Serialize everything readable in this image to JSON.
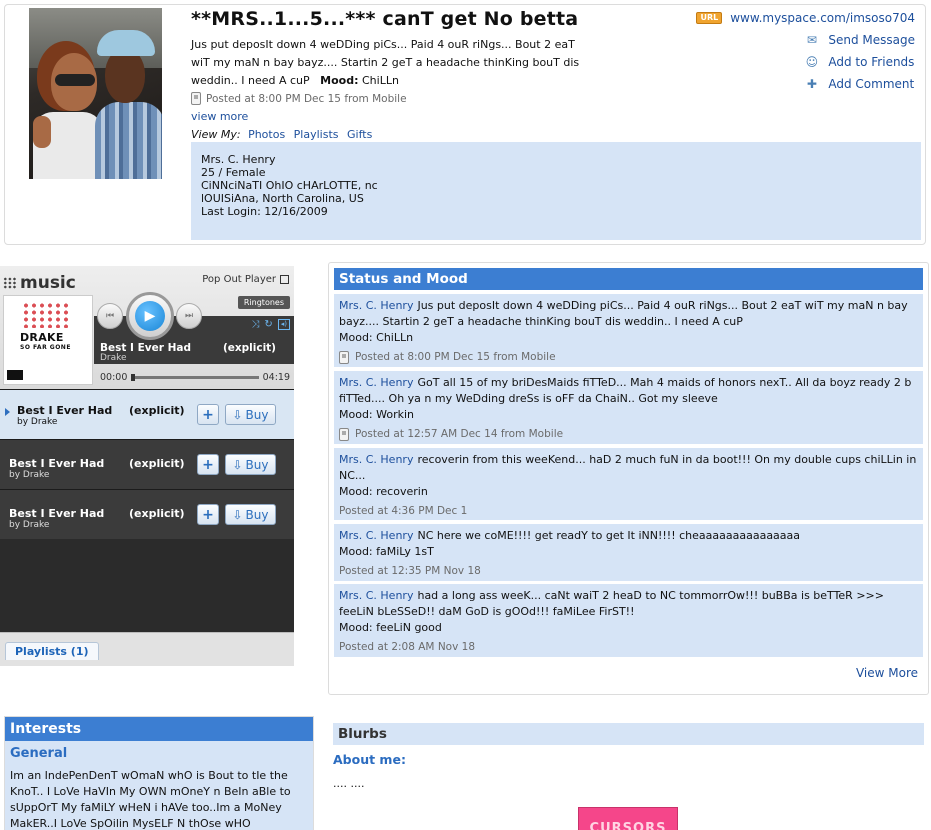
{
  "profile": {
    "name": "**MRS..1...5...*** canT get No betta",
    "headline": "Jus put deposIt down 4 weDDing piCs... Paid 4 ouR riNgs... Bout 2 eaT wiT my maN n bay bayz.... Startin 2 geT a headache thinKing bouT dis weddin.. I need A cuP",
    "mood_label": "Mood:",
    "mood_value": "ChiLLn",
    "posted": "Posted at 8:00 PM Dec 15 from Mobile",
    "view_more": "view more",
    "view_my_label": "View My:",
    "view_my_links": [
      "Photos",
      "Playlists",
      "Gifts"
    ],
    "url_badge": "URL",
    "url": "www.myspace.com/imsoso704",
    "actions": [
      {
        "label": "Send Message",
        "icon": "pencil-envelope-icon"
      },
      {
        "label": "Add to Friends",
        "icon": "add-friend-icon"
      },
      {
        "label": "Add Comment",
        "icon": "comment-icon"
      }
    ],
    "details": [
      "Mrs. C. Henry",
      "25 / Female",
      "CiNNciNaTI OhIO cHArLOTTE, nc",
      "lOUISiAna, North Carolina, US",
      "Last Login: 12/16/2009"
    ]
  },
  "player": {
    "logo_text": "music",
    "popout_label": "Pop Out Player",
    "album_title": "DRAKE",
    "album_sub": "SO FAR GONE",
    "ringtones_label": "Ringtones",
    "now_title": "Best I Ever Had",
    "now_artist": "Drake",
    "now_explicit": "(explicit)",
    "time_current": "00:00",
    "time_total": "04:19",
    "tracks": [
      {
        "title": "Best I Ever Had",
        "artist": "by Drake",
        "explicit": "(explicit)",
        "plus": "+",
        "buy": "Buy"
      },
      {
        "title": "Best I Ever Had",
        "artist": "by Drake",
        "explicit": "(explicit)",
        "plus": "+",
        "buy": "Buy"
      },
      {
        "title": "Best I Ever Had",
        "artist": "by Drake",
        "explicit": "(explicit)",
        "plus": "+",
        "buy": "Buy"
      }
    ],
    "playlists_tab": "Playlists (1)"
  },
  "status": {
    "heading": "Status and Mood",
    "items": [
      {
        "who": "Mrs. C. Henry",
        "text": "Jus put deposIt down 4 weDDing piCs... Paid 4 ouR riNgs... Bout 2 eaT wiT my maN n bay bayz.... Startin 2 geT a headache thinKing bouT dis weddin.. I need A cuP",
        "mood": "Mood: ChiLLn",
        "posted": "Posted at 8:00 PM Dec 15 from Mobile",
        "mobile": true
      },
      {
        "who": "Mrs. C. Henry",
        "text": "GoT all 15 of my briDesMaids fiTTeD... Mah 4 maids of honors nexT.. All da boyz ready 2 b fiTTed.... Oh ya n my WeDding dreSs is oFF da ChaiN.. Got my sleeve",
        "mood": "Mood: Workin",
        "posted": "Posted at 12:57 AM Dec 14 from Mobile",
        "mobile": true
      },
      {
        "who": "Mrs. C. Henry",
        "text": "recoverin from this weeKend... haD 2 much fuN in da boot!!! On my double cups chiLLin in NC...",
        "mood": "Mood: recoverin",
        "posted": "Posted at 4:36 PM Dec 1",
        "mobile": false
      },
      {
        "who": "Mrs. C. Henry",
        "text": "NC here we coME!!!! get readY to get It iNN!!!! cheaaaaaaaaaaaaaaa",
        "mood": "Mood: faMiLy 1sT",
        "posted": "Posted at 12:35 PM Nov 18",
        "mobile": false
      },
      {
        "who": "Mrs. C. Henry",
        "text": "had a long ass weeK... caNt waiT 2 heaD to NC tommorrOw!!! buBBa is beTTeR >>> feeLiN bLeSSeD!! daM GoD is gOOd!!! faMiLee FirST!!",
        "mood": "Mood: feeLiN good",
        "posted": "Posted at 2:08 AM Nov 18",
        "mobile": false
      }
    ],
    "view_more": "View More"
  },
  "interests": {
    "heading": "Interests",
    "sub": "General",
    "text": "Im an IndePenDenT wOmaN whO is Bout to tIe the KnoT.. I LoVe HaVIn My OWN mOneY n BeIn aBle to sUppOrT My faMiLY wHeN i hAVe too..Im a MoNey MakER..I LoVe SpOilin MysELF N thOse wHO"
  },
  "blurbs": {
    "heading": "Blurbs",
    "about_label": "About me:",
    "about_text": ".... ....",
    "pink_box_text": "CURSORS"
  }
}
